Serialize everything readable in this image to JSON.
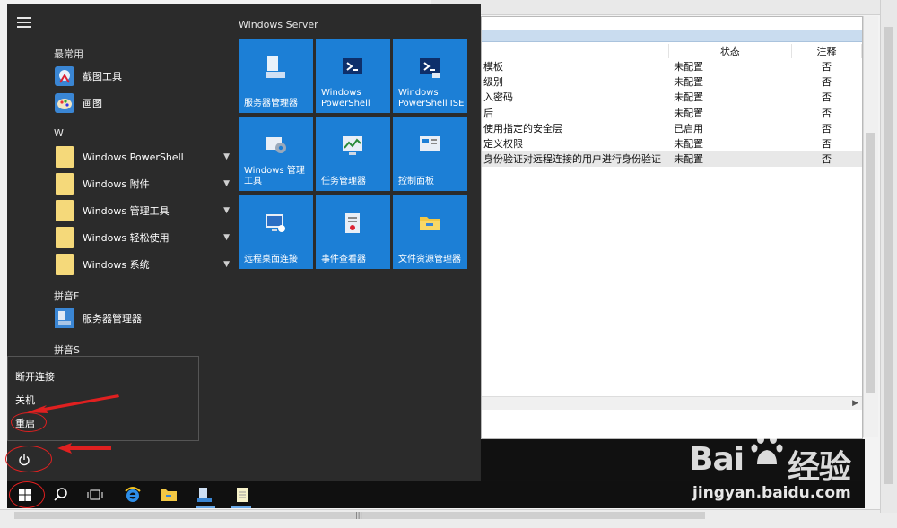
{
  "policy_table": {
    "headers": {
      "status": "状态",
      "note": "注释"
    },
    "rows": [
      {
        "name": "模板",
        "status": "未配置",
        "note": "否"
      },
      {
        "name": "级别",
        "status": "未配置",
        "note": "否"
      },
      {
        "name": "入密码",
        "status": "未配置",
        "note": "否"
      },
      {
        "name": "后",
        "status": "未配置",
        "note": "否"
      },
      {
        "name": "使用指定的安全层",
        "status": "已启用",
        "note": "否"
      },
      {
        "name": "定义权限",
        "status": "未配置",
        "note": "否"
      },
      {
        "name": "身份验证对远程连接的用户进行身份验证",
        "status": "未配置",
        "note": "否"
      }
    ]
  },
  "start_menu": {
    "most_used_label": "最常用",
    "most_used": [
      {
        "label": "截图工具",
        "icon": "snipping-tool-icon"
      },
      {
        "label": "画图",
        "icon": "paint-icon"
      }
    ],
    "group_w": "W",
    "w_items": [
      {
        "label": "Windows PowerShell",
        "icon": "folder-icon"
      },
      {
        "label": "Windows 附件",
        "icon": "folder-icon"
      },
      {
        "label": "Windows 管理工具",
        "icon": "folder-icon"
      },
      {
        "label": "Windows 轻松使用",
        "icon": "folder-icon"
      },
      {
        "label": "Windows 系统",
        "icon": "folder-icon"
      }
    ],
    "group_f": "拼音F",
    "f_items": [
      {
        "label": "服务器管理器",
        "icon": "server-manager-icon"
      }
    ],
    "group_s": "拼音S"
  },
  "tiles": {
    "title": "Windows Server",
    "items": [
      {
        "label": "服务器管理器",
        "icon": "server-manager-icon"
      },
      {
        "label": "Windows PowerShell",
        "icon": "powershell-icon"
      },
      {
        "label": "Windows PowerShell ISE",
        "icon": "powershell-ise-icon"
      },
      {
        "label": "Windows 管理工具",
        "icon": "admin-tools-icon"
      },
      {
        "label": "任务管理器",
        "icon": "task-manager-icon"
      },
      {
        "label": "控制面板",
        "icon": "control-panel-icon"
      },
      {
        "label": "远程桌面连接",
        "icon": "remote-desktop-icon"
      },
      {
        "label": "事件查看器",
        "icon": "event-viewer-icon"
      },
      {
        "label": "文件资源管理器",
        "icon": "file-explorer-icon"
      }
    ]
  },
  "power_menu": {
    "disconnect": "断开连接",
    "shutdown": "关机",
    "restart": "重启"
  },
  "taskbar": {
    "icons": [
      "windows-start-icon",
      "search-icon",
      "task-view-icon",
      "internet-explorer-icon",
      "file-explorer-icon",
      "server-manager-icon",
      "notepad-icon"
    ]
  },
  "watermark": {
    "brand_left": "Bai",
    "brand_right": "经验",
    "url": "jingyan.baidu.com"
  },
  "colors": {
    "tile_blue": "#1c7fd6",
    "start_bg": "#2b2b2b",
    "annotation_red": "#e02020"
  }
}
